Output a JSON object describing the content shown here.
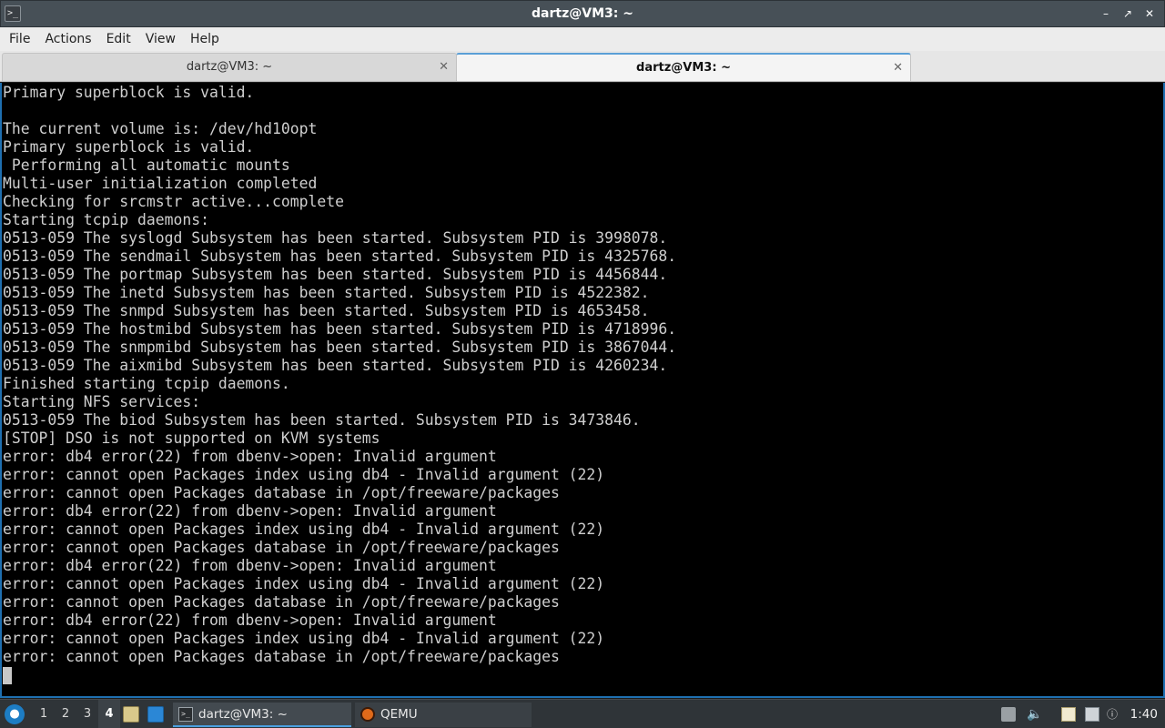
{
  "window": {
    "title": "dartz@VM3: ~",
    "app_icon": "terminal-icon",
    "controls": [
      "minimize",
      "maximize",
      "close"
    ]
  },
  "menu": {
    "items": [
      "File",
      "Actions",
      "Edit",
      "View",
      "Help"
    ]
  },
  "tabs": [
    {
      "label": "dartz@VM3: ~",
      "active": false
    },
    {
      "label": "dartz@VM3: ~",
      "active": true
    }
  ],
  "terminal": {
    "lines": [
      "Primary superblock is valid.",
      "",
      "The current volume is: /dev/hd10opt",
      "Primary superblock is valid.",
      " Performing all automatic mounts",
      "Multi-user initialization completed",
      "Checking for srcmstr active...complete",
      "Starting tcpip daemons:",
      "0513-059 The syslogd Subsystem has been started. Subsystem PID is 3998078.",
      "0513-059 The sendmail Subsystem has been started. Subsystem PID is 4325768.",
      "0513-059 The portmap Subsystem has been started. Subsystem PID is 4456844.",
      "0513-059 The inetd Subsystem has been started. Subsystem PID is 4522382.",
      "0513-059 The snmpd Subsystem has been started. Subsystem PID is 4653458.",
      "0513-059 The hostmibd Subsystem has been started. Subsystem PID is 4718996.",
      "0513-059 The snmpmibd Subsystem has been started. Subsystem PID is 3867044.",
      "0513-059 The aixmibd Subsystem has been started. Subsystem PID is 4260234.",
      "Finished starting tcpip daemons.",
      "Starting NFS services:",
      "0513-059 The biod Subsystem has been started. Subsystem PID is 3473846.",
      "[STOP] DSO is not supported on KVM systems",
      "error: db4 error(22) from dbenv->open: Invalid argument",
      "error: cannot open Packages index using db4 - Invalid argument (22)",
      "error: cannot open Packages database in /opt/freeware/packages",
      "error: db4 error(22) from dbenv->open: Invalid argument",
      "error: cannot open Packages index using db4 - Invalid argument (22)",
      "error: cannot open Packages database in /opt/freeware/packages",
      "error: db4 error(22) from dbenv->open: Invalid argument",
      "error: cannot open Packages index using db4 - Invalid argument (22)",
      "error: cannot open Packages database in /opt/freeware/packages",
      "error: db4 error(22) from dbenv->open: Invalid argument",
      "error: cannot open Packages index using db4 - Invalid argument (22)",
      "error: cannot open Packages database in /opt/freeware/packages"
    ]
  },
  "taskbar": {
    "desktops": [
      "1",
      "2",
      "3",
      "4"
    ],
    "current_desktop": "4",
    "tasks": [
      {
        "label": "dartz@VM3: ~",
        "icon": "terminal-icon"
      },
      {
        "label": "QEMU",
        "icon": "qemu-icon"
      }
    ],
    "clock": "1:40"
  },
  "colors": {
    "terminal_bg": "#000000",
    "terminal_fg": "#cfcfcf",
    "accent": "#1e6fb0"
  }
}
